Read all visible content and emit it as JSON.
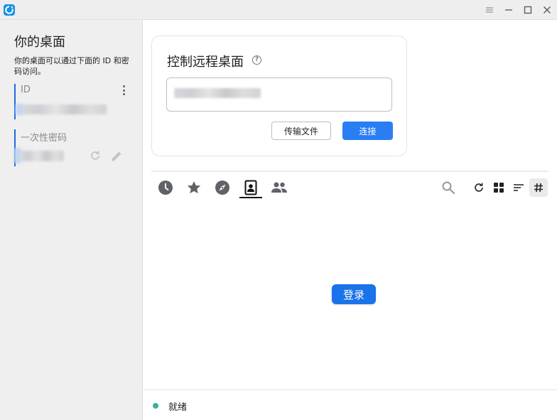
{
  "window": {
    "controls": [
      "menu",
      "minimize",
      "maximize",
      "close"
    ]
  },
  "left_panel": {
    "title": "你的桌面",
    "description": "你的桌面可以通过下面的 ID 和密码访问。",
    "id_label": "ID",
    "password_label": "一次性密码"
  },
  "control_card": {
    "title": "控制远程桌面",
    "transfer_button": "传输文件",
    "connect_button": "连接"
  },
  "tabs": [
    {
      "icon": "clock-icon",
      "name": "recent-sessions"
    },
    {
      "icon": "star-icon",
      "name": "favorites"
    },
    {
      "icon": "compass-icon",
      "name": "discovered"
    },
    {
      "icon": "address-book-icon",
      "name": "address-book",
      "active": true
    },
    {
      "icon": "group-icon",
      "name": "group"
    }
  ],
  "toolbar_icons": [
    "search-icon",
    "refresh-icon",
    "grid-view-icon",
    "sort-icon",
    "hash-icon"
  ],
  "main": {
    "login_button": "登录"
  },
  "status": {
    "text": "就绪",
    "color": "#37b39b"
  },
  "colors": {
    "accent": "#2a7ef4",
    "login": "#1a73e8",
    "active_field_bar": "#1e6bdf"
  }
}
